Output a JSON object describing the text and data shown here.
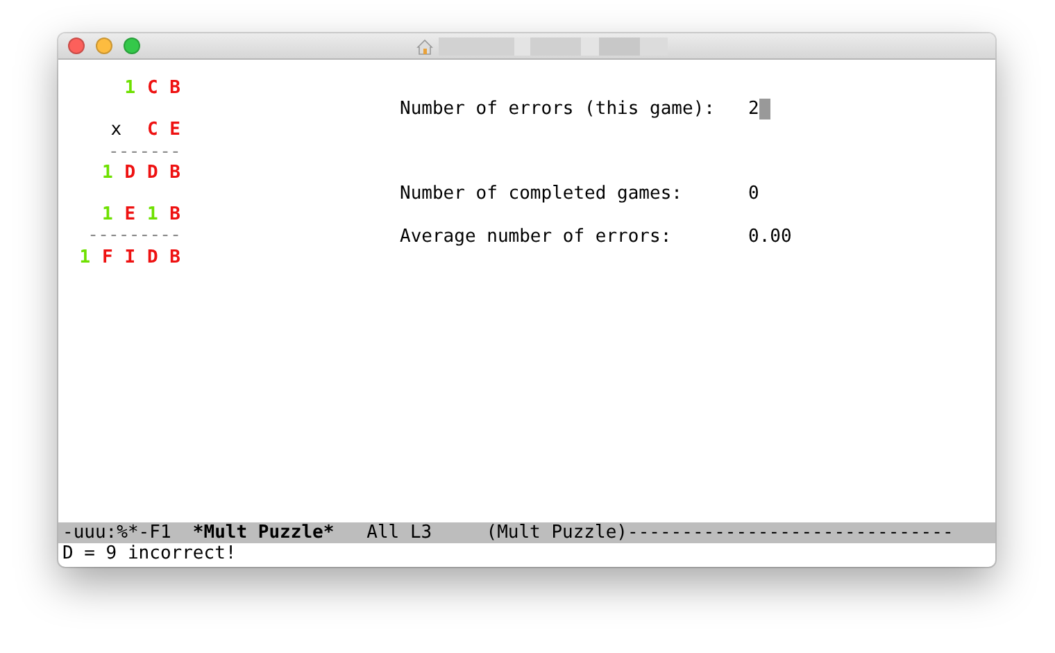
{
  "window": {
    "controls": [
      {
        "kind": "close"
      },
      {
        "kind": "minimize"
      },
      {
        "kind": "zoom"
      }
    ]
  },
  "puzzle": [
    [
      {
        "tokens": [
          {
            "text": "1",
            "kind": "digit"
          },
          {
            "text": "C",
            "kind": "letter"
          },
          {
            "text": "B",
            "kind": "letter"
          }
        ]
      }
    ],
    [
      {
        "tokens": [
          {
            "text": "x",
            "kind": "operator"
          },
          {
            "text": "C",
            "kind": "letter"
          },
          {
            "text": "E",
            "kind": "letter"
          }
        ]
      },
      {
        "tokens": [
          {
            "text": "-------",
            "kind": "rule"
          }
        ]
      },
      {
        "tokens": [
          {
            "text": "1",
            "kind": "digit"
          },
          {
            "text": "D",
            "kind": "letter"
          },
          {
            "text": "D",
            "kind": "letter"
          },
          {
            "text": "B",
            "kind": "letter"
          }
        ]
      }
    ],
    [
      {
        "tokens": [
          {
            "text": "1",
            "kind": "digit"
          },
          {
            "text": "E",
            "kind": "letter"
          },
          {
            "text": "1",
            "kind": "digit"
          },
          {
            "text": "B",
            "kind": "letter"
          }
        ]
      },
      {
        "tokens": [
          {
            "text": "---------",
            "kind": "rule"
          }
        ]
      },
      {
        "tokens": [
          {
            "text": "1",
            "kind": "digit"
          },
          {
            "text": "F",
            "kind": "letter"
          },
          {
            "text": "I",
            "kind": "letter"
          },
          {
            "text": "D",
            "kind": "letter"
          },
          {
            "text": "B",
            "kind": "letter"
          }
        ]
      }
    ]
  ],
  "stats": [
    [
      {
        "label": "Number of errors (this game):",
        "value": "2",
        "cursor": true
      }
    ],
    [
      {
        "label": "Number of completed games:",
        "value": "0",
        "cursor": false
      },
      {
        "label": "Average number of errors:",
        "value": "0.00",
        "cursor": false
      }
    ]
  ],
  "mode_line": [
    {
      "text": "-uuu:%*-F1  ",
      "bold": false
    },
    {
      "text": "*Mult Puzzle*",
      "bold": true
    },
    {
      "text": "   All L3     (Mult Puzzle)------------------------------",
      "bold": false
    }
  ],
  "echo_area": "D = 9 incorrect!"
}
